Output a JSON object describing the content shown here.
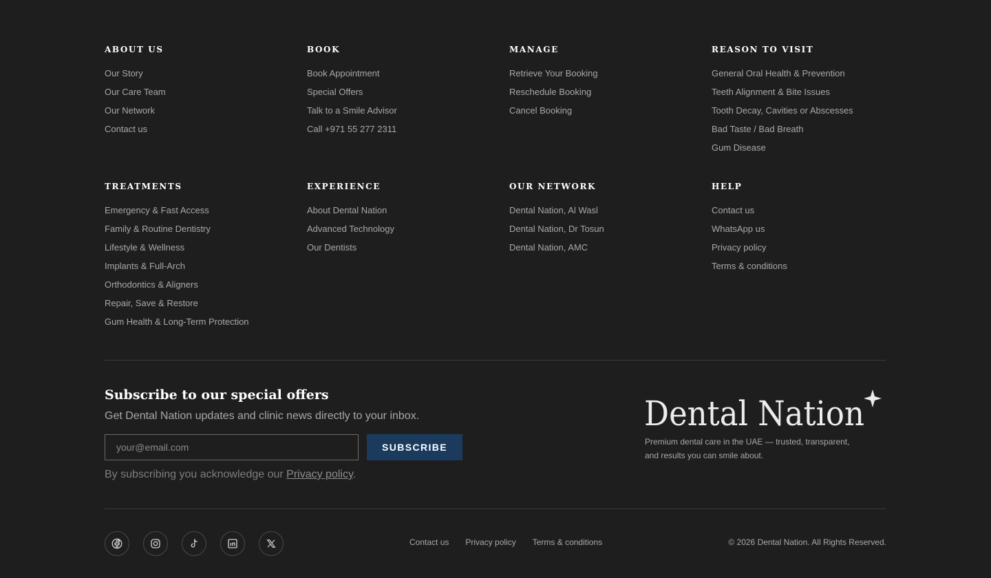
{
  "sections_row1": [
    {
      "heading": "ABOUT US",
      "links": [
        "Our Story",
        "Our Care Team",
        "Our Network",
        "Contact us"
      ]
    },
    {
      "heading": "BOOK",
      "links": [
        "Book Appointment",
        "Special Offers",
        "Talk to a Smile Advisor",
        "Call +971 55 277 2311"
      ]
    },
    {
      "heading": "MANAGE",
      "links": [
        "Retrieve Your Booking",
        "Reschedule Booking",
        "Cancel Booking"
      ]
    },
    {
      "heading": "REASON TO VISIT",
      "links": [
        "General Oral Health & Prevention",
        "Teeth Alignment & Bite Issues",
        "Tooth Decay, Cavities or Abscesses",
        "Bad Taste / Bad Breath",
        "Gum Disease"
      ]
    }
  ],
  "sections_row2": [
    {
      "heading": "TREATMENTS",
      "links": [
        "Emergency & Fast Access",
        "Family & Routine Dentistry",
        "Lifestyle & Wellness",
        "Implants & Full-Arch",
        "Orthodontics & Aligners",
        "Repair, Save & Restore",
        "Gum Health & Long-Term Protection"
      ]
    },
    {
      "heading": "EXPERIENCE",
      "links": [
        "About Dental Nation",
        "Advanced Technology",
        "Our Dentists"
      ]
    },
    {
      "heading": "OUR NETWORK",
      "links": [
        "Dental Nation, Al Wasl",
        "Dental Nation, Dr Tosun",
        "Dental Nation, AMC"
      ]
    },
    {
      "heading": "HELP",
      "links": [
        "Contact us",
        "WhatsApp us",
        "Privacy policy",
        "Terms & conditions"
      ]
    }
  ],
  "newsletter": {
    "title": "Subscribe to our special offers",
    "description": "Get Dental Nation updates and clinic news directly to your inbox.",
    "email_placeholder": "your@email.com",
    "button_label": "SUBSCRIBE",
    "ack_prefix": "By subscribing you acknowledge our ",
    "ack_link": "Privacy policy",
    "ack_suffix": "."
  },
  "brand": {
    "logo_text": "Dental Nation",
    "tagline": "Premium dental care in the UAE — trusted, transparent, and results you can smile about."
  },
  "socials": [
    "facebook-icon",
    "instagram-icon",
    "tiktok-icon",
    "linkedin-icon",
    "x-icon"
  ],
  "bottom_links": [
    "Contact us",
    "Privacy policy",
    "Terms & conditions"
  ],
  "copyright": "© 2026 Dental Nation. All Rights Reserved.",
  "colors": {
    "background": "#1e1e1e",
    "accent": "#1b3b5e",
    "heading": "#ffffff",
    "text": "#a9a9a9"
  }
}
